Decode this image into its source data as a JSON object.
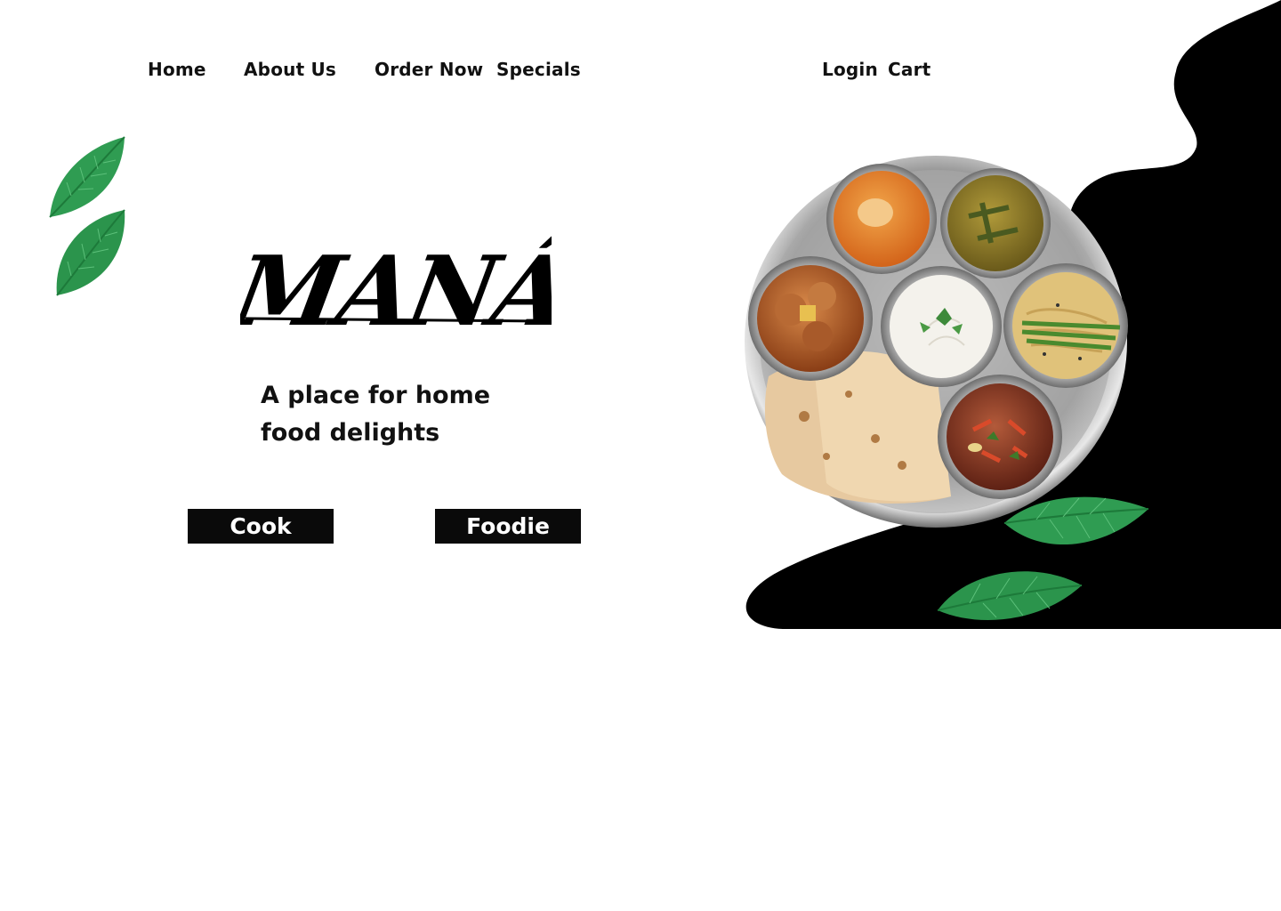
{
  "nav": {
    "home": "Home",
    "about": "About Us",
    "order": "Order Now",
    "specials": "Specials",
    "login": "Login",
    "cart": "Cart"
  },
  "brand": {
    "logo_text": "MANÁ"
  },
  "hero": {
    "tagline": "A place for home food delights"
  },
  "buttons": {
    "cook": "Cook",
    "foodie": "Foodie"
  },
  "colors": {
    "background": "#ffffff",
    "blob": "#000000",
    "leaf": "#2e9a4e",
    "button_bg": "#0a0a0a",
    "button_text": "#ffffff"
  },
  "icons": {
    "leaf": "leaf-icon",
    "thali": "thali-plate-image"
  }
}
